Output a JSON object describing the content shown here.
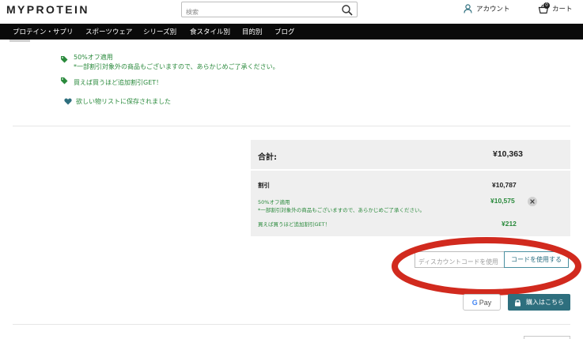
{
  "header": {
    "logo": "MYPROTEIN",
    "search_placeholder": "検索",
    "account_label": "アカウント",
    "cart_label": "カート",
    "cart_count": "0"
  },
  "nav": {
    "items": [
      "プロテイン・サプリ",
      "スポーツウェア",
      "シリーズ別",
      "食スタイル別",
      "目的別",
      "ブログ"
    ]
  },
  "notices": {
    "promo_title": "50%オフ適用",
    "promo_note": "*一部割引対象外の商品もございますので、あらかじめご了承ください。",
    "bulk_offer": "買えば買うほど追加割引GET！",
    "wishlist": "欲しい物リストに保存されました"
  },
  "summary": {
    "total_label": "合計:",
    "total_value": "¥10,363",
    "discount_label": "割引",
    "discount_value": "¥10,787",
    "promo_title": "50%オフ適用",
    "promo_note": "*一部割引対象外の商品もございますので、あらかじめご了承ください。",
    "promo_value": "¥10,575",
    "bulk_label": "買えば買うほど追加割引GET！",
    "bulk_value": "¥212"
  },
  "discount": {
    "placeholder": "ディスカウントコードを使用",
    "button_label": "コードを使用する"
  },
  "payment": {
    "gpay_label": "Pay",
    "checkout_label": "購入はこちら"
  },
  "colors": {
    "accent_green": "#2a8a3c",
    "teal": "#2e6f7e",
    "highlight_red": "#d12a1e",
    "nav_bg": "#0a0a0a"
  }
}
